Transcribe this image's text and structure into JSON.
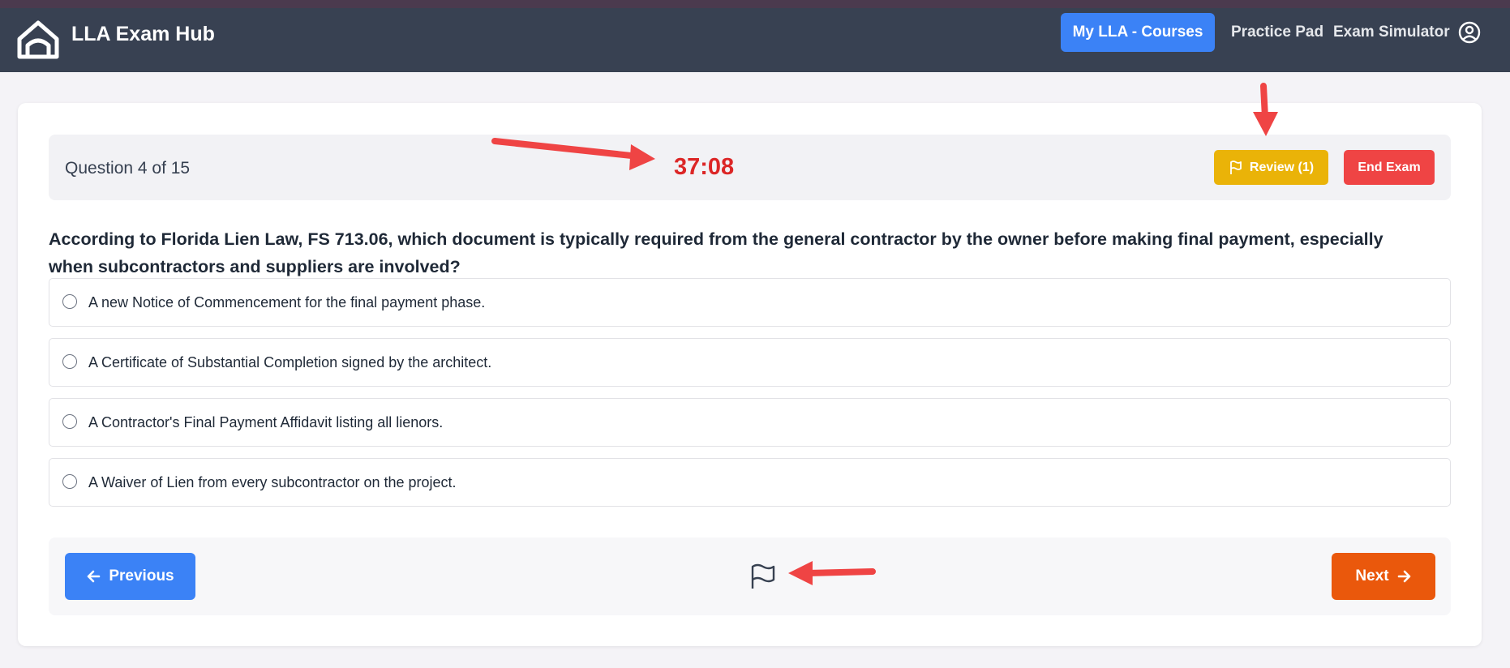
{
  "navbar": {
    "brand": "LLA Exam Hub",
    "courses_label": "My LLA - Courses",
    "practice_label": "Practice Pad",
    "simulator_label": "Exam Simulator",
    "user_icon": "user-circle-icon",
    "logo_icon": "house-logo-icon"
  },
  "exam": {
    "question_counter": "Question 4 of 15",
    "timer": "37:08",
    "review_label": "Review (1)",
    "end_label": "End Exam",
    "question_text": "According to Florida Lien Law, FS 713.06, which document is typically required from the general contractor by the owner before making final payment, especially when subcontractors and suppliers are involved?",
    "options": [
      {
        "label": "A new Notice of Commencement for the final payment phase."
      },
      {
        "label": "A Certificate of Substantial Completion signed by the architect."
      },
      {
        "label": "A Contractor's Final Payment Affidavit listing all lienors."
      },
      {
        "label": "A Waiver of Lien from every subcontractor on the project."
      }
    ]
  },
  "footer": {
    "prev_label": "Previous",
    "next_label": "Next",
    "flag_icon": "flag-icon"
  },
  "colors": {
    "navbar": "#384152",
    "primary": "#3b82f6",
    "timer": "#dc2626",
    "review": "#eab308",
    "end": "#ef4444",
    "next": "#ea580c",
    "annotation_arrow": "#ef4444"
  }
}
